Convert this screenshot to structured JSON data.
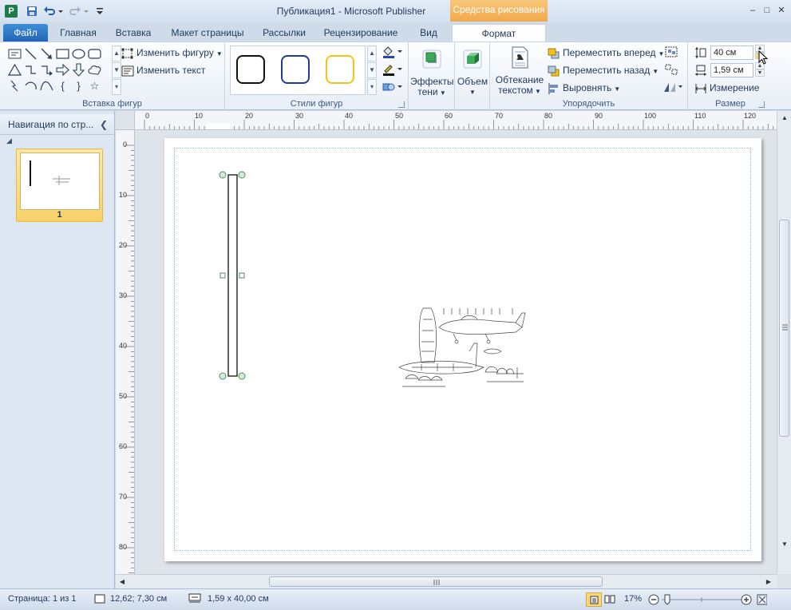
{
  "window": {
    "title": "Публикация1 - Microsoft Publisher",
    "app_icon": "P",
    "context_tab_group": "Средства рисования"
  },
  "tabs": {
    "file": "Файл",
    "home": "Главная",
    "insert": "Вставка",
    "page_layout": "Макет страницы",
    "mailings": "Рассылки",
    "review": "Рецензирование",
    "view": "Вид",
    "format": "Формат"
  },
  "ribbon": {
    "insert_shapes": {
      "label": "Вставка фигур",
      "edit_shape": "Изменить фигуру",
      "edit_text": "Изменить текст"
    },
    "shape_styles": {
      "label": "Стили фигур",
      "swatch_colors": [
        "#111111",
        "#1f3a9e",
        "#f2c318"
      ]
    },
    "shadow_effects": {
      "label_line1": "Эффекты",
      "label_line2": "тени"
    },
    "volume": {
      "label": "Объем"
    },
    "arrange": {
      "label": "Упорядочить",
      "wrap_text_line1": "Обтекание",
      "wrap_text_line2": "текстом",
      "bring_forward": "Переместить вперед",
      "send_backward": "Переместить назад",
      "align": "Выровнять"
    },
    "size": {
      "label": "Размер",
      "height_value": "40 см",
      "width_value": "1,59 см",
      "measurement": "Измерение"
    }
  },
  "nav_pane": {
    "title": "Навигация по стр...",
    "page_number": "1"
  },
  "ruler": {
    "h_labels": [
      "0",
      "10",
      "20",
      "30",
      "40",
      "50",
      "60",
      "70",
      "80",
      "90",
      "100",
      "110",
      "120"
    ],
    "v_labels": [
      "0",
      "10",
      "20",
      "30",
      "40",
      "50",
      "60",
      "70",
      "80"
    ]
  },
  "status": {
    "page": "Страница: 1 из 1",
    "position": "12,62; 7,30 см",
    "size": "1,59 x 40,00 см",
    "zoom": "17%"
  }
}
